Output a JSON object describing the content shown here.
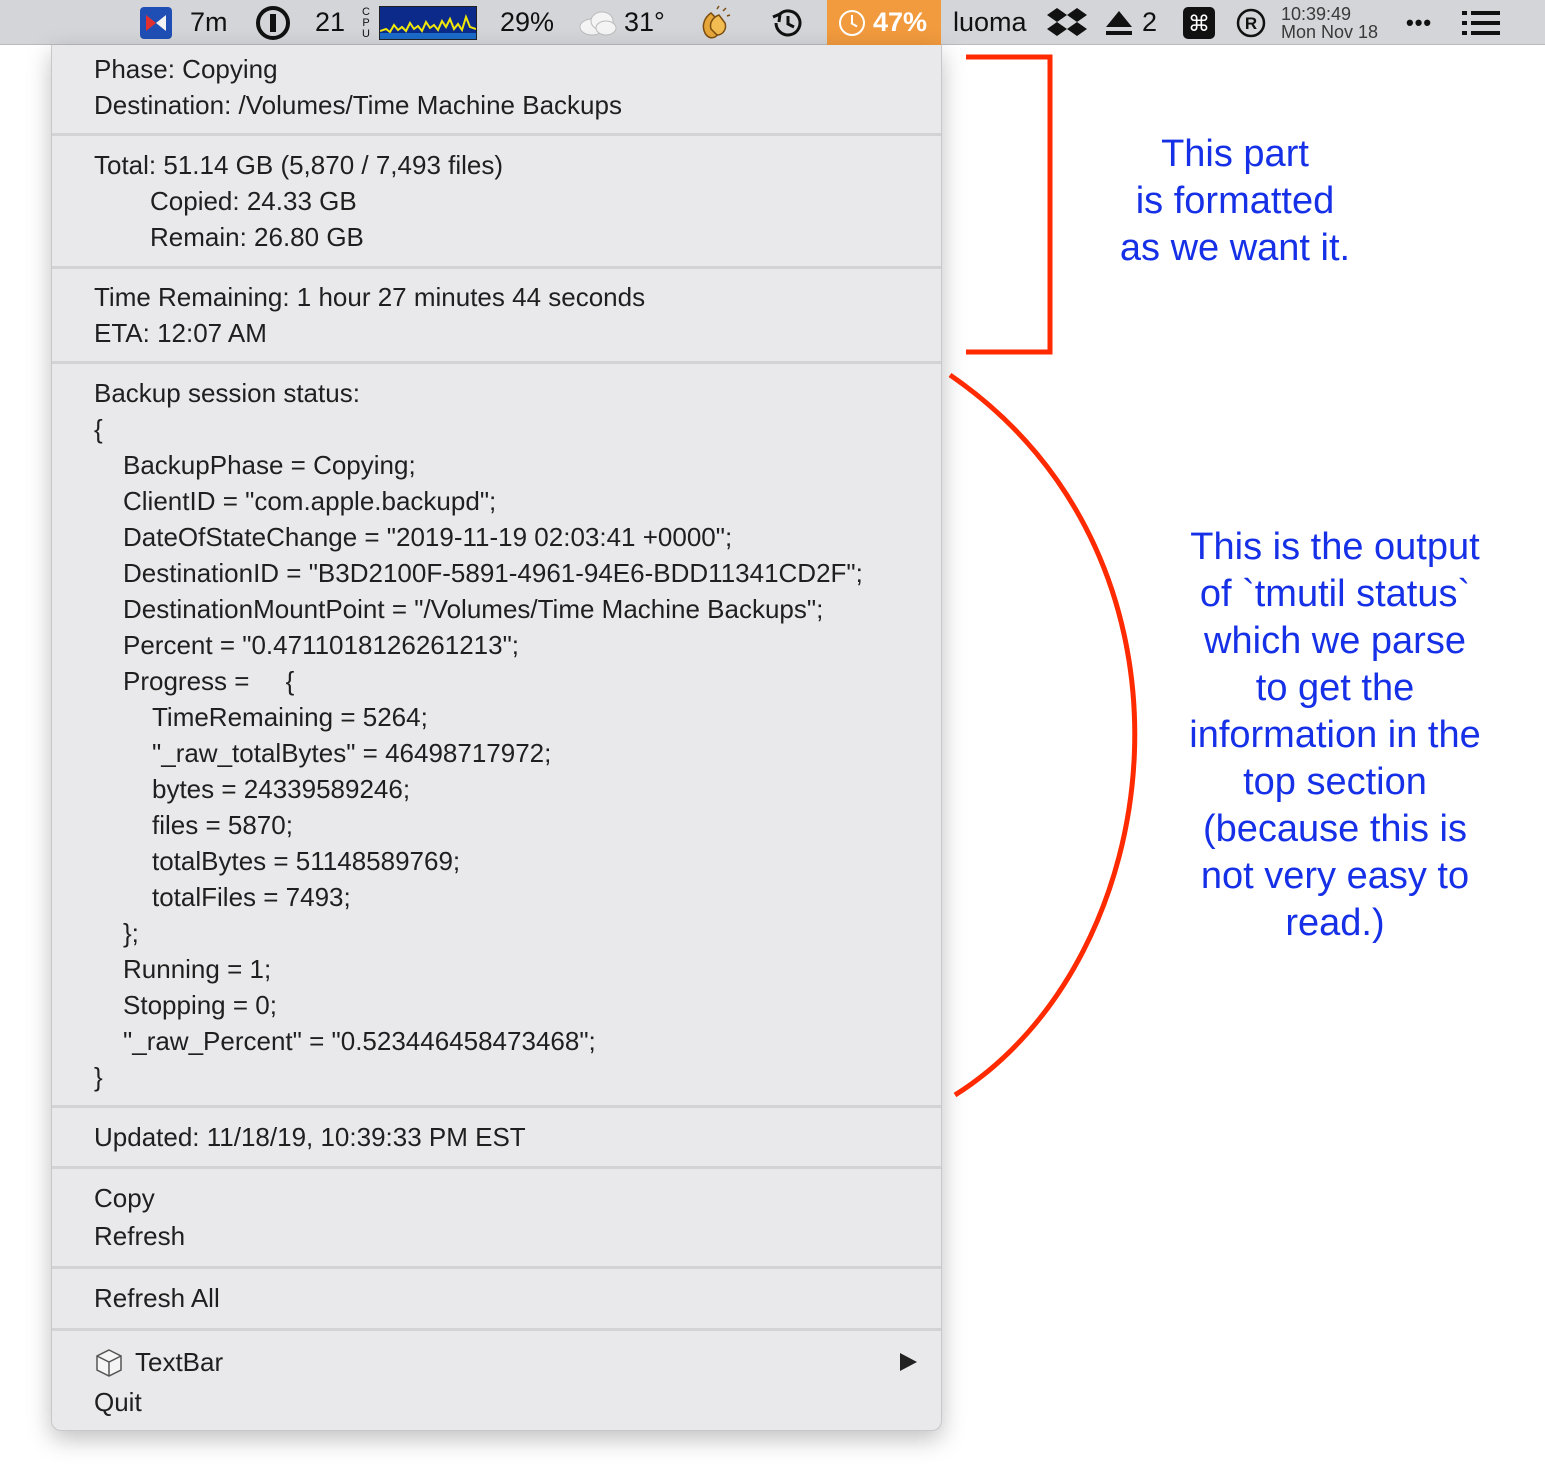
{
  "menubar": {
    "timer_text": "7m",
    "onepassword_count": "21",
    "cpu_vertical_label": "CPU",
    "cpu_percent": "29%",
    "weather_temp": "31°",
    "time_machine_percent": "47%",
    "username": "luoma",
    "eject_count": "2",
    "clock_time": "10:39:49",
    "clock_date": "Mon Nov 18",
    "more_glyph": "•••",
    "colors": {
      "menubar_bg": "#d4d5d9",
      "time_machine_badge": "#f19a3e",
      "cpu_graph_bg": "#0b2a8a",
      "cpu_graph_line": "#f1e80a"
    }
  },
  "menu": {
    "phase": "Phase: Copying",
    "destination": "Destination: /Volumes/Time Machine Backups",
    "total": "Total: 51.14 GB (5,870 / 7,493 files)",
    "copied": "Copied: 24.33 GB",
    "remain": "Remain: 26.80 GB",
    "time_remaining": "Time Remaining: 1 hour 27 minutes 44 seconds",
    "eta": "ETA: 12:07 AM",
    "status_header": "Backup session status:",
    "status_lines": [
      "{",
      "BackupPhase = Copying;",
      "ClientID = \"com.apple.backupd\";",
      "DateOfStateChange = \"2019-11-19 02:03:41 +0000\";",
      "DestinationID = \"B3D2100F-5891-4961-94E6-BDD11341CD2F\";",
      "DestinationMountPoint = \"/Volumes/Time Machine Backups\";",
      "Percent = \"0.4711018126261213\";",
      "Progress =     {",
      "TimeRemaining = 5264;",
      "\"_raw_totalBytes\" = 46498717972;",
      "bytes = 24339589246;",
      "files = 5870;",
      "totalBytes = 51148589769;",
      "totalFiles = 7493;",
      "};",
      "Running = 1;",
      "Stopping = 0;",
      "\"_raw_Percent\" = \"0.523446458473468\";",
      "}"
    ],
    "updated": "Updated: 11/18/19, 10:39:33 PM EST",
    "copy_label": "Copy",
    "refresh_label": "Refresh",
    "refresh_all_label": "Refresh All",
    "textbar_label": "TextBar",
    "quit_label": "Quit"
  },
  "annotations": {
    "top_note": [
      "This part",
      "is formatted",
      "as we want it."
    ],
    "bottom_note": [
      "This is the output",
      "of `tmutil status`",
      "which we parse",
      "to get the",
      "information in the",
      "top section",
      "(because this is",
      "not very easy to",
      "read.)"
    ],
    "colors": {
      "text": "#1530e6",
      "marks": "#ff2a00"
    }
  }
}
